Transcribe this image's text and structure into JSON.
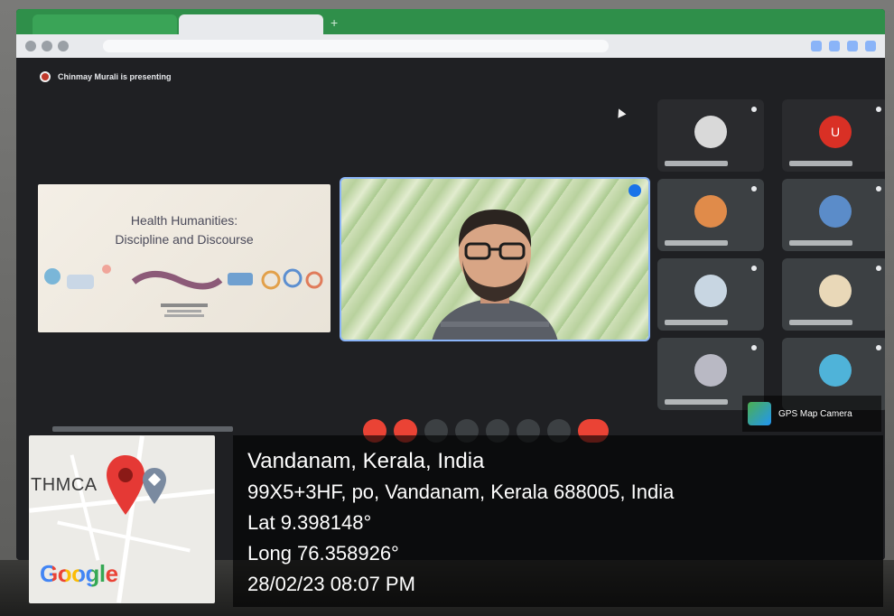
{
  "meet": {
    "presenting_text": "Chinmay Murali is presenting",
    "slide_title_line1": "Health Humanities:",
    "slide_title_line2": "Discipline and Discourse",
    "participant_u_initial": "U"
  },
  "gps_overlay": {
    "brand": "GPS Map Camera",
    "place": "Vandanam, Kerala, India",
    "address": "99X5+3HF, po, Vandanam, Kerala 688005, India",
    "lat": "Lat 9.398148°",
    "long": "Long 76.358926°",
    "datetime": "28/02/23 08:07 PM"
  },
  "map": {
    "place_label": "THMCA",
    "provider": "Google"
  },
  "colors": {
    "pin_red": "#e53935",
    "pin_gray": "#7a8aa0",
    "accent_blue": "#8ab4f8",
    "end_call_red": "#ea4335"
  }
}
